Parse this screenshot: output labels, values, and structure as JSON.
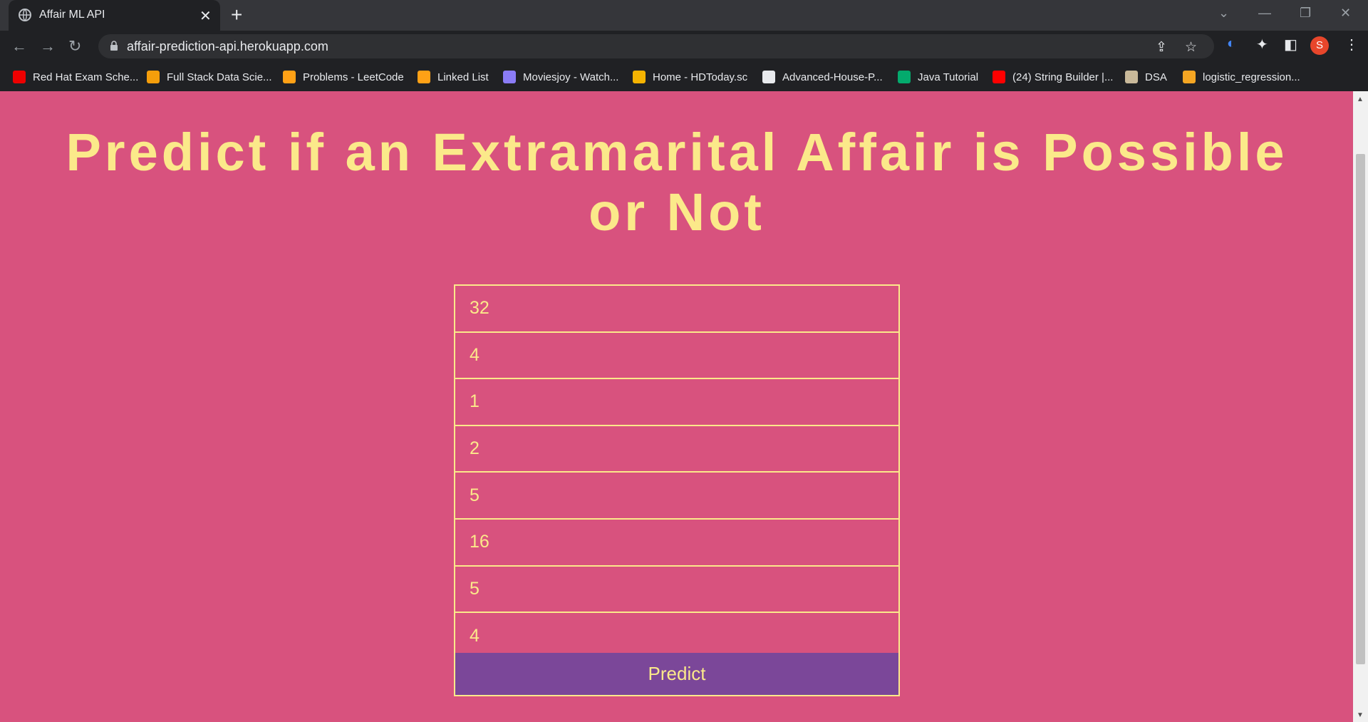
{
  "browser": {
    "tab_title": "Affair ML API",
    "url": "affair-prediction-api.herokuapp.com",
    "profile_initial": "S",
    "bookmarks": [
      {
        "label": "Red Hat Exam Sche...",
        "icon": "redhat-icon",
        "color": "#e00"
      },
      {
        "label": "Full Stack Data Scie...",
        "icon": "ineuron-icon",
        "color": "#f59e0b"
      },
      {
        "label": "Problems - LeetCode",
        "icon": "leetcode-icon",
        "color": "#ffa116"
      },
      {
        "label": "Linked List",
        "icon": "leetcode-icon",
        "color": "#ffa116"
      },
      {
        "label": "Moviesjoy - Watch...",
        "icon": "moviesjoy-icon",
        "color": "#8b7cf6"
      },
      {
        "label": "Home - HDToday.sc",
        "icon": "hd-icon",
        "color": "#f5b301"
      },
      {
        "label": "Advanced-House-P...",
        "icon": "github-icon",
        "color": "#e8eaed"
      },
      {
        "label": "Java Tutorial",
        "icon": "w3-icon",
        "color": "#04aa6d"
      },
      {
        "label": "(24) String Builder |...",
        "icon": "youtube-icon",
        "color": "#ff0000"
      },
      {
        "label": "DSA",
        "icon": "cc-icon",
        "color": "#c9b99a"
      },
      {
        "label": "logistic_regression...",
        "icon": "notebook-icon",
        "color": "#f5a623"
      }
    ]
  },
  "page": {
    "heading": "Predict if an Extramarital Affair is Possible or Not",
    "fields": [
      "32",
      "4",
      "1",
      "2",
      "5",
      "16",
      "5",
      "4"
    ],
    "button_label": "Predict"
  }
}
